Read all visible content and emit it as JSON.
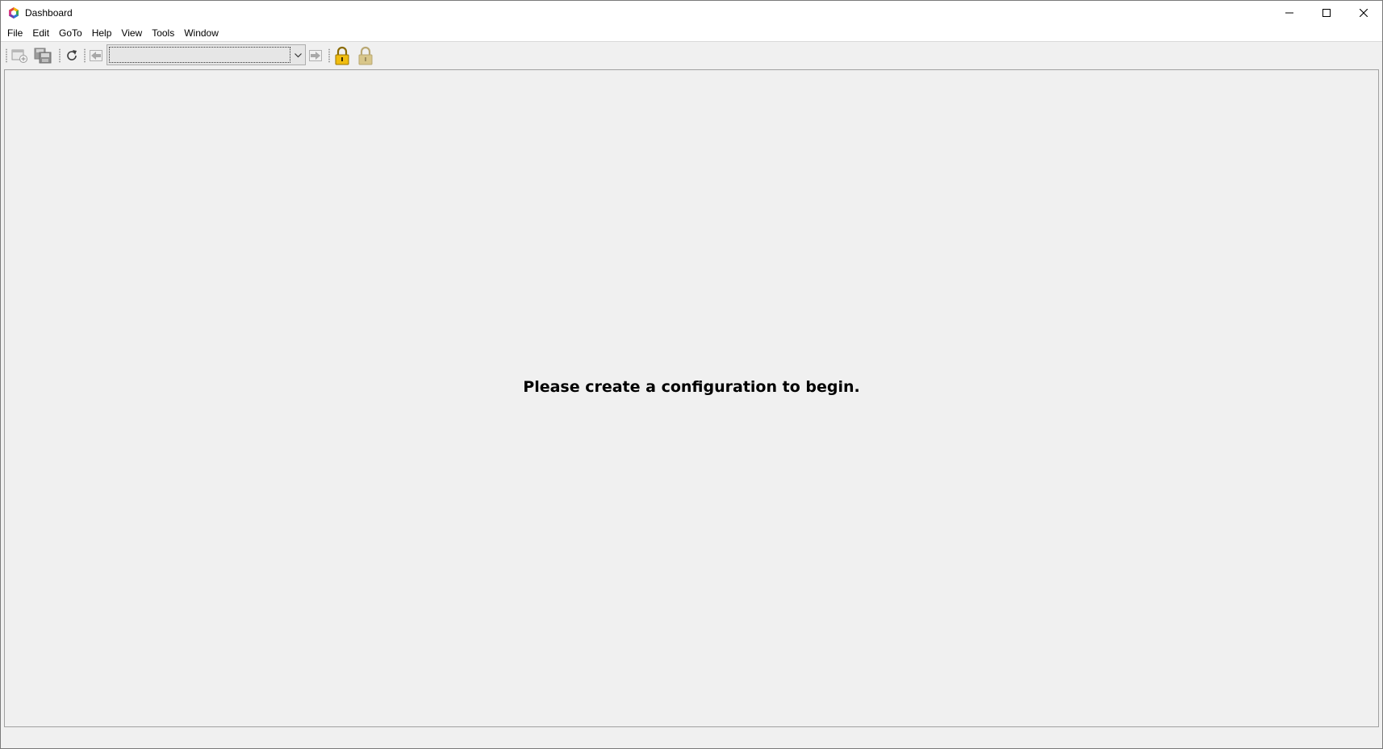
{
  "window": {
    "title": "Dashboard",
    "app_icon": "hexagon-logo-icon"
  },
  "caption_buttons": {
    "minimize_icon": "minimize-icon",
    "maximize_icon": "maximize-icon",
    "close_icon": "close-icon"
  },
  "menu": {
    "items": [
      {
        "label": "File"
      },
      {
        "label": "Edit"
      },
      {
        "label": "GoTo"
      },
      {
        "label": "Help"
      },
      {
        "label": "View"
      },
      {
        "label": "Tools"
      },
      {
        "label": "Window"
      }
    ]
  },
  "toolbar": {
    "buttons": [
      {
        "icon": "new-configuration-icon",
        "enabled": false
      },
      {
        "icon": "save-icon",
        "enabled": false
      },
      {
        "icon": "refresh-icon",
        "enabled": true
      },
      {
        "icon": "back-arrow-icon",
        "enabled": false
      },
      {
        "icon": "forward-arrow-icon",
        "enabled": false
      },
      {
        "icon": "lock-icon",
        "enabled": true
      },
      {
        "icon": "unlock-icon",
        "enabled": false
      }
    ],
    "configuration_select": {
      "value": ""
    }
  },
  "main": {
    "empty_message": "Please create a configuration to begin."
  },
  "colors": {
    "background": "#f0f0f0",
    "titlebar": "#ffffff",
    "lock_gold": "#e8b400"
  }
}
